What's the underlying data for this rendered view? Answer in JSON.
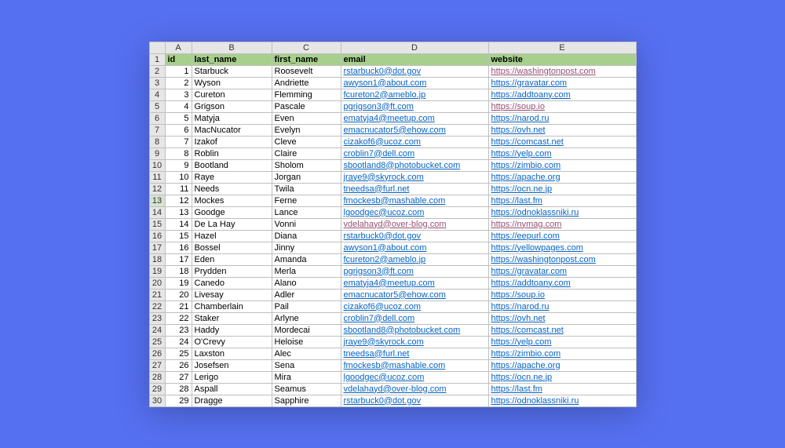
{
  "columns": [
    "A",
    "B",
    "C",
    "D",
    "E"
  ],
  "headers": {
    "id": "id",
    "last_name": "last_name",
    "first_name": "first_name",
    "email": "email",
    "website": "website"
  },
  "selected_row_index": 12,
  "rows": [
    {
      "n": 2,
      "id": 1,
      "last": "Starbuck",
      "first": "Roosevelt",
      "email": "rstarbuck0@dot.gov",
      "email_visited": false,
      "site": "https://washingtonpost.com",
      "site_visited": true
    },
    {
      "n": 3,
      "id": 2,
      "last": "Wyson",
      "first": "Andriette",
      "email": "awyson1@about.com",
      "email_visited": false,
      "site": "https://gravatar.com",
      "site_visited": false
    },
    {
      "n": 4,
      "id": 3,
      "last": "Cureton",
      "first": "Flemming",
      "email": "fcureton2@ameblo.jp",
      "email_visited": false,
      "site": "https://addtoany.com",
      "site_visited": false
    },
    {
      "n": 5,
      "id": 4,
      "last": "Grigson",
      "first": "Pascale",
      "email": "pgrigson3@ft.com",
      "email_visited": false,
      "site": "https://soup.io",
      "site_visited": true
    },
    {
      "n": 6,
      "id": 5,
      "last": "Matyja",
      "first": "Even",
      "email": "ematyja4@meetup.com",
      "email_visited": false,
      "site": "https://narod.ru",
      "site_visited": false
    },
    {
      "n": 7,
      "id": 6,
      "last": "MacNucator",
      "first": "Evelyn",
      "email": "emacnucator5@ehow.com",
      "email_visited": false,
      "site": "https://ovh.net",
      "site_visited": false
    },
    {
      "n": 8,
      "id": 7,
      "last": "Izakof",
      "first": "Cleve",
      "email": "cizakof6@ucoz.com",
      "email_visited": false,
      "site": "https://comcast.net",
      "site_visited": false
    },
    {
      "n": 9,
      "id": 8,
      "last": "Roblin",
      "first": "Claire",
      "email": "croblin7@dell.com",
      "email_visited": false,
      "site": "https://yelp.com",
      "site_visited": false
    },
    {
      "n": 10,
      "id": 9,
      "last": "Bootland",
      "first": "Sholom",
      "email": "sbootland8@photobucket.com",
      "email_visited": false,
      "site": "https://zimbio.com",
      "site_visited": false
    },
    {
      "n": 11,
      "id": 10,
      "last": "Raye",
      "first": "Jorgan",
      "email": "jraye9@skyrock.com",
      "email_visited": false,
      "site": "https://apache.org",
      "site_visited": false
    },
    {
      "n": 12,
      "id": 11,
      "last": "Needs",
      "first": "Twila",
      "email": "tneedsa@furl.net",
      "email_visited": false,
      "site": "https://ocn.ne.jp",
      "site_visited": false
    },
    {
      "n": 13,
      "id": 12,
      "last": "Mockes",
      "first": "Ferne",
      "email": "fmockesb@mashable.com",
      "email_visited": false,
      "site": "https://last.fm",
      "site_visited": false
    },
    {
      "n": 14,
      "id": 13,
      "last": "Goodge",
      "first": "Lance",
      "email": "lgoodgec@ucoz.com",
      "email_visited": false,
      "site": "https://odnoklassniki.ru",
      "site_visited": false
    },
    {
      "n": 15,
      "id": 14,
      "last": "De La Hay",
      "first": "Vonni",
      "email": "vdelahayd@over-blog.com",
      "email_visited": true,
      "site": "https://nymag.com",
      "site_visited": true
    },
    {
      "n": 16,
      "id": 15,
      "last": "Hazel",
      "first": "Diana",
      "email": "rstarbuck0@dot.gov",
      "email_visited": false,
      "site": "https://eepurl.com",
      "site_visited": false
    },
    {
      "n": 17,
      "id": 16,
      "last": "Bossel",
      "first": "Jinny",
      "email": "awyson1@about.com",
      "email_visited": false,
      "site": "https://yellowpages.com",
      "site_visited": false
    },
    {
      "n": 18,
      "id": 17,
      "last": "Eden",
      "first": "Amanda",
      "email": "fcureton2@ameblo.jp",
      "email_visited": false,
      "site": "https://washingtonpost.com",
      "site_visited": false
    },
    {
      "n": 19,
      "id": 18,
      "last": "Prydden",
      "first": "Merla",
      "email": "pgrigson3@ft.com",
      "email_visited": false,
      "site": "https://gravatar.com",
      "site_visited": false
    },
    {
      "n": 20,
      "id": 19,
      "last": "Canedo",
      "first": "Alano",
      "email": "ematyja4@meetup.com",
      "email_visited": false,
      "site": "https://addtoany.com",
      "site_visited": false
    },
    {
      "n": 21,
      "id": 20,
      "last": "Livesay",
      "first": "Adler",
      "email": "emacnucator5@ehow.com",
      "email_visited": false,
      "site": "https://soup.io",
      "site_visited": false
    },
    {
      "n": 22,
      "id": 21,
      "last": "Chamberlain",
      "first": "Pail",
      "email": "cizakof6@ucoz.com",
      "email_visited": false,
      "site": "https://narod.ru",
      "site_visited": false
    },
    {
      "n": 23,
      "id": 22,
      "last": "Staker",
      "first": "Arlyne",
      "email": "croblin7@dell.com",
      "email_visited": false,
      "site": "https://ovh.net",
      "site_visited": false
    },
    {
      "n": 24,
      "id": 23,
      "last": "Haddy",
      "first": "Mordecai",
      "email": "sbootland8@photobucket.com",
      "email_visited": false,
      "site": "https://comcast.net",
      "site_visited": false
    },
    {
      "n": 25,
      "id": 24,
      "last": "O'Crevy",
      "first": "Heloise",
      "email": "jraye9@skyrock.com",
      "email_visited": false,
      "site": "https://yelp.com",
      "site_visited": false
    },
    {
      "n": 26,
      "id": 25,
      "last": "Laxston",
      "first": "Alec",
      "email": "tneedsa@furl.net",
      "email_visited": false,
      "site": "https://zimbio.com",
      "site_visited": false
    },
    {
      "n": 27,
      "id": 26,
      "last": "Josefsen",
      "first": "Sena",
      "email": "fmockesb@mashable.com",
      "email_visited": false,
      "site": "https://apache.org",
      "site_visited": false
    },
    {
      "n": 28,
      "id": 27,
      "last": "Lerigo",
      "first": "Mira",
      "email": "lgoodgec@ucoz.com",
      "email_visited": false,
      "site": "https://ocn.ne.jp",
      "site_visited": false
    },
    {
      "n": 29,
      "id": 28,
      "last": "Aspall",
      "first": "Seamus",
      "email": "vdelahayd@over-blog.com",
      "email_visited": false,
      "site": "https://last.fm",
      "site_visited": false
    },
    {
      "n": 30,
      "id": 29,
      "last": "Dragge",
      "first": "Sapphire",
      "email": "rstarbuck0@dot.gov",
      "email_visited": false,
      "site": "https://odnoklassniki.ru",
      "site_visited": false
    }
  ]
}
